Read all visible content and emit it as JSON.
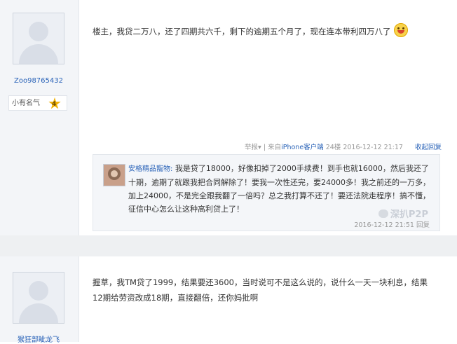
{
  "post1": {
    "username": "Zoo98765432",
    "rank_label": "小有名气",
    "rank_level": "4",
    "text": "楼主，我贷二万八，还了四期共六千，剩下的逾期五个月了，现在连本带利四万八了",
    "meta": {
      "report": "举报",
      "report_arrow": "▾",
      "sep": "|",
      "source_prefix": "来自",
      "source": "iPhone客户端",
      "floor": "24楼",
      "time": "2016-12-12 21:17",
      "reply": "收起回复"
    },
    "reply": {
      "name": "安格精品寵物:",
      "text": "我是贷了18000，好像扣掉了2000手续费！到手也就16000，然后我还了十期，逾期了就跟我把合同解除了！要我一次性还完，要24000多！我之前还的一万多，加上24000，不是完全跟我翻了一倍吗？总之我打算不还了！要还法院走程序！搞不懂，征信中心怎么让这种高利贷上了！",
      "time": "2016-12-12 21:51",
      "action": "回复"
    },
    "watermark": "深扒P2P"
  },
  "post2": {
    "username": "猴狂部眦龙飞",
    "text": "握草，我TM贷了1999，结果要还3600，当时说可不是这么说的，说什么一天一块利息，结果12期给劳资改成18期，直接翻倍，还你妈批啊"
  }
}
